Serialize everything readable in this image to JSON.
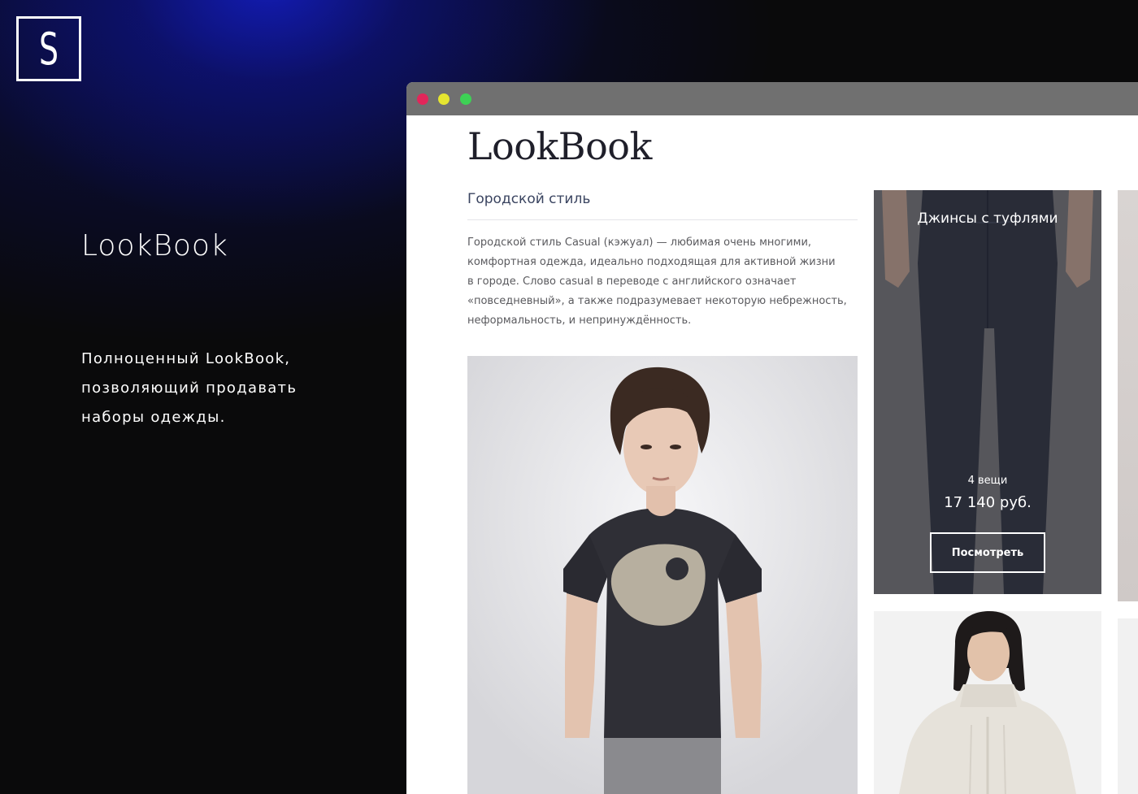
{
  "brand": {
    "logo_letter": "S"
  },
  "hero": {
    "title": "LookBook",
    "description_lines": [
      "Полноценный LookBook,",
      "позволяющий продавать",
      "наборы одежды."
    ]
  },
  "browser": {
    "window_controls": [
      "close",
      "minimize",
      "maximize"
    ],
    "colors": {
      "close": "#e2265a",
      "minimize": "#e5e530",
      "maximize": "#3dd155"
    }
  },
  "page": {
    "title": "LookBook",
    "section": {
      "title": "Городской стиль",
      "text_lines": [
        "Городской стиль Casual (кэжуал) — любимая очень многими,",
        "комфортная одежда, идеально подходящая для активной жизни",
        "в городе. Слово casual в переводе с английского означает",
        "«повседневный», а также подразумевает некоторую небрежность,",
        "неформальность, и непринуждённость."
      ]
    },
    "look": {
      "name": "Джинсы с туфлями",
      "items_count": "4 вещи",
      "price": "17 140 руб.",
      "button_label": "Посмотреть"
    }
  }
}
